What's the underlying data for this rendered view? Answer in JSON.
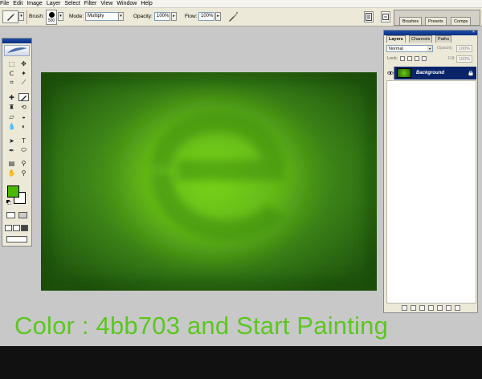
{
  "menu": [
    "File",
    "Edit",
    "Image",
    "Layer",
    "Select",
    "Filter",
    "View",
    "Window",
    "Help"
  ],
  "options_bar": {
    "brush_label": "Brush:",
    "brush_size": "500",
    "mode_label": "Mode:",
    "mode_value": "Multiply",
    "opacity_label": "Opacity:",
    "opacity_value": "100%",
    "flow_label": "Flow:",
    "flow_value": "100%"
  },
  "palette_well": {
    "tabs": [
      "Brushes",
      "Presets",
      "Comps"
    ]
  },
  "foreground_color": "#4bb703",
  "background_color": "#ffffff",
  "layers_panel": {
    "tabs": [
      "Layers",
      "Channels",
      "Paths"
    ],
    "blend_mode": "Normal",
    "opacity_label": "Opacity:",
    "opacity_value": "100%",
    "lock_label": "Lock:",
    "fill_label": "Fill:",
    "fill_value": "100%",
    "layer_name": "Background"
  },
  "caption": "Color : 4bb703 and Start Painting"
}
